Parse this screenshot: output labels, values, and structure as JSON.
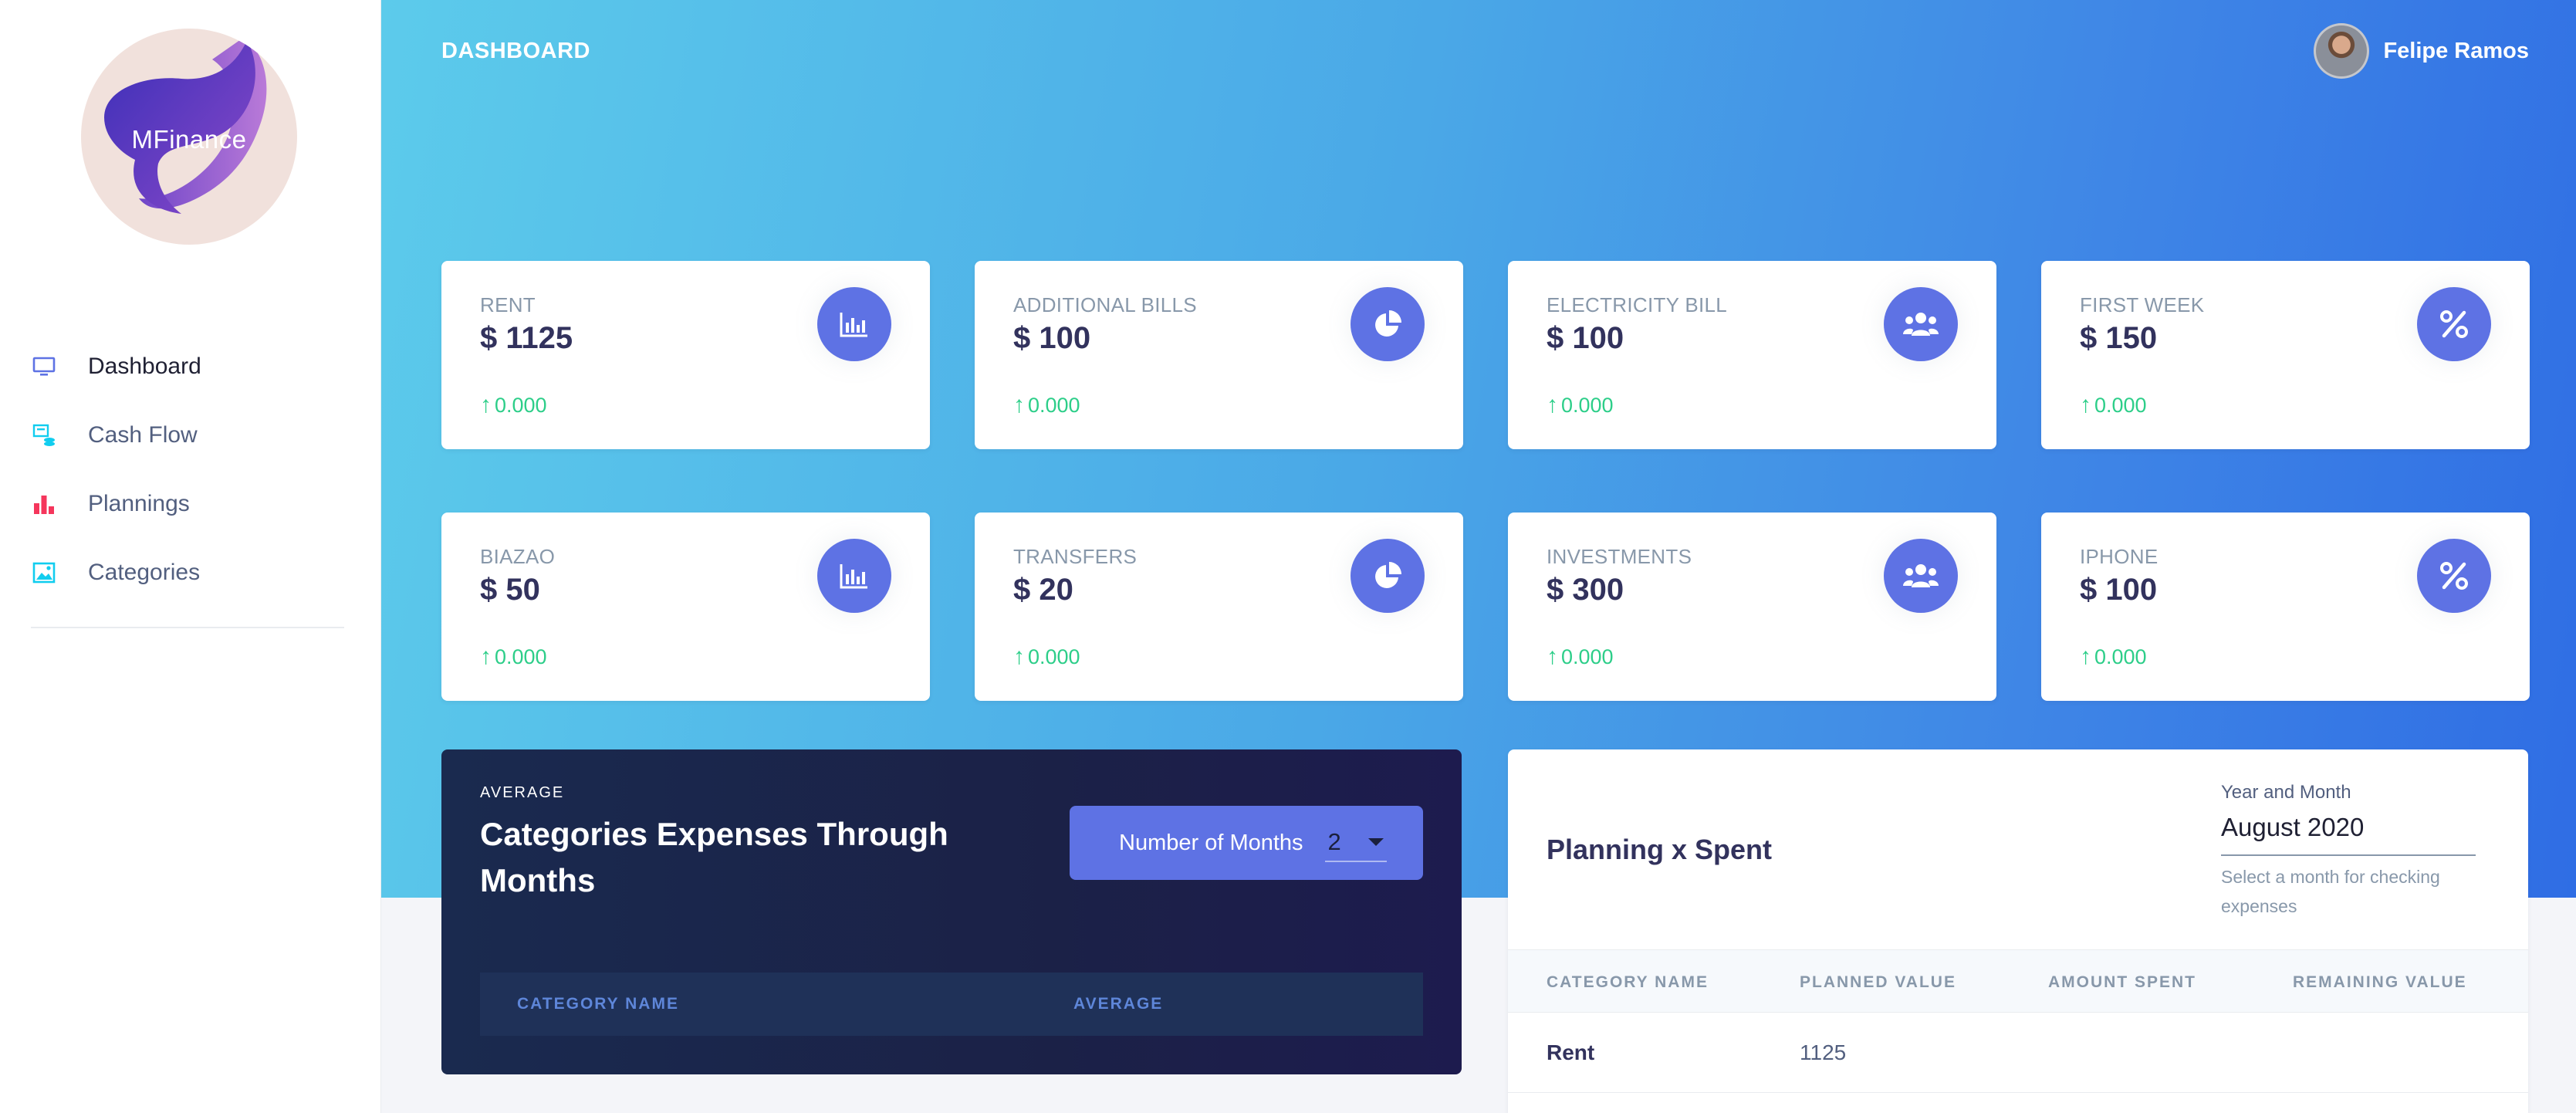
{
  "app": {
    "logo_text": "MFinance"
  },
  "header": {
    "title": "DASHBOARD",
    "user_name": "Felipe Ramos"
  },
  "sidebar": {
    "items": [
      {
        "label": "Dashboard",
        "icon": "monitor-icon",
        "active": true
      },
      {
        "label": "Cash Flow",
        "icon": "cash-flow-icon"
      },
      {
        "label": "Plannings",
        "icon": "bar-chart-icon"
      },
      {
        "label": "Categories",
        "icon": "image-icon"
      }
    ]
  },
  "cards": [
    {
      "title": "RENT",
      "value": "$ 1125",
      "change": "0.000",
      "icon": "chart-bar-icon"
    },
    {
      "title": "ADDITIONAL BILLS",
      "value": "$ 100",
      "change": "0.000",
      "icon": "chart-pie-icon"
    },
    {
      "title": "ELECTRICITY BILL",
      "value": "$ 100",
      "change": "0.000",
      "icon": "users-icon"
    },
    {
      "title": "FIRST WEEK",
      "value": "$ 150",
      "change": "0.000",
      "icon": "percent-icon"
    },
    {
      "title": "BIAZAO",
      "value": "$ 50",
      "change": "0.000",
      "icon": "chart-bar-icon"
    },
    {
      "title": "TRANSFERS",
      "value": "$ 20",
      "change": "0.000",
      "icon": "chart-pie-icon"
    },
    {
      "title": "INVESTMENTS",
      "value": "$ 300",
      "change": "0.000",
      "icon": "users-icon"
    },
    {
      "title": "IPHONE",
      "value": "$ 100",
      "change": "0.000",
      "icon": "percent-icon"
    }
  ],
  "average": {
    "eyebrow": "AVERAGE",
    "title": "Categories Expenses Through Months",
    "months_label": "Number of Months",
    "months_value": "2",
    "columns": [
      "CATEGORY NAME",
      "AVERAGE"
    ]
  },
  "planning": {
    "title": "Planning x Spent",
    "year_month_label": "Year and Month",
    "year_month_value": "August 2020",
    "year_month_help": "Select a month for checking expenses",
    "columns": [
      "CATEGORY NAME",
      "PLANNED VALUE",
      "AMOUNT SPENT",
      "REMAINING VALUE"
    ],
    "rows": [
      {
        "name": "Rent",
        "planned": "1125",
        "spent": "",
        "remaining": ""
      }
    ]
  },
  "colors": {
    "accent": "#5e72e4",
    "success": "#2dce89",
    "hero_start": "#5ccbeb",
    "hero_end": "#2f6de4",
    "dark_panel": "#1b2147"
  }
}
